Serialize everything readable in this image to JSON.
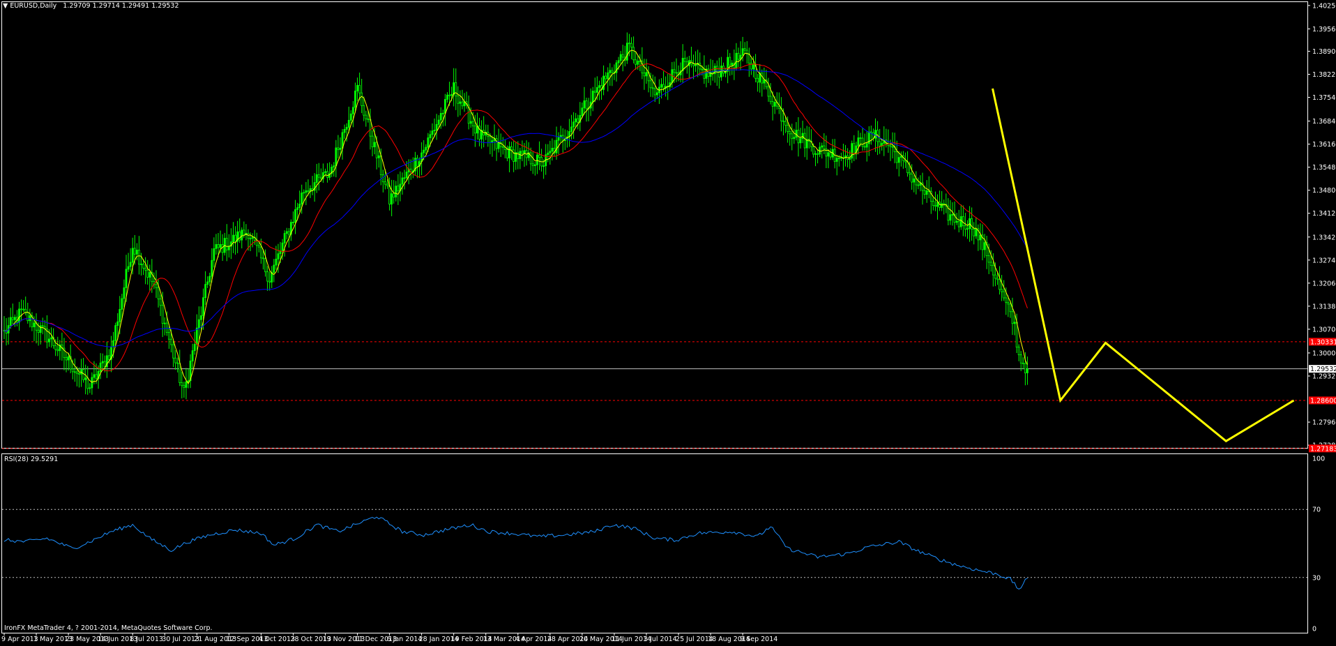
{
  "header": {
    "symbol_label": "EURUSD,Daily",
    "ohlc": "1.29709 1.29714 1.29491 1.29532"
  },
  "footer": {
    "copyright": "IronFX MetaTrader 4, ? 2001-2014, MetaQuotes Software Corp."
  },
  "colors": {
    "background": "#000000",
    "candle": "#00ff00",
    "ma_fast": "#ffff00",
    "ma_mid": "#ff0000",
    "ma_slow": "#0000ff",
    "rsi_line": "#1e90ff",
    "level_lines": "#ff0000",
    "projection": "#ffff00",
    "bid_line": "#c0c0c0"
  },
  "chart_data": [
    {
      "type": "candlestick",
      "symbol": "EURUSD",
      "timeframe": "Daily",
      "y_ticks": [
        "1.40250",
        "1.39560",
        "1.38900",
        "1.38220",
        "1.37540",
        "1.36840",
        "1.36160",
        "1.35480",
        "1.34800",
        "1.34120",
        "1.33420",
        "1.32740",
        "1.32060",
        "1.31380",
        "1.30700",
        "1.30000",
        "1.29320",
        "1.27960",
        "1.27280"
      ],
      "ylim": [
        1.272,
        1.4035
      ],
      "x_ticks": [
        "9 Apr 2013",
        "1 May 2013",
        "23 May 2013",
        "14 Jun 2013",
        "8 Jul 2013",
        "30 Jul 2013",
        "21 Aug 2013",
        "12 Sep 2013",
        "4 Oct 2013",
        "28 Oct 2013",
        "19 Nov 2013",
        "11 Dec 2013",
        "6 Jan 2014",
        "28 Jan 2014",
        "19 Feb 2014",
        "13 Mar 2014",
        "4 Apr 2014",
        "28 Apr 2014",
        "20 May 2014",
        "11 Jun 2014",
        "3 Jul 2014",
        "25 Jul 2014",
        "18 Aug 2014",
        "9 Sep 2014"
      ],
      "close_anchors": [
        [
          0,
          1.306
        ],
        [
          8,
          1.312
        ],
        [
          20,
          1.305
        ],
        [
          40,
          1.29
        ],
        [
          50,
          1.301
        ],
        [
          60,
          1.332
        ],
        [
          70,
          1.32
        ],
        [
          84,
          1.288
        ],
        [
          98,
          1.33
        ],
        [
          114,
          1.336
        ],
        [
          124,
          1.322
        ],
        [
          140,
          1.348
        ],
        [
          152,
          1.353
        ],
        [
          165,
          1.378
        ],
        [
          180,
          1.345
        ],
        [
          196,
          1.36
        ],
        [
          210,
          1.378
        ],
        [
          222,
          1.364
        ],
        [
          236,
          1.359
        ],
        [
          252,
          1.356
        ],
        [
          268,
          1.37
        ],
        [
          282,
          1.382
        ],
        [
          292,
          1.39
        ],
        [
          304,
          1.376
        ],
        [
          316,
          1.385
        ],
        [
          330,
          1.382
        ],
        [
          346,
          1.388
        ],
        [
          354,
          1.38
        ],
        [
          368,
          1.365
        ],
        [
          380,
          1.36
        ],
        [
          392,
          1.358
        ],
        [
          400,
          1.362
        ],
        [
          406,
          1.364
        ],
        [
          414,
          1.361
        ],
        [
          424,
          1.352
        ],
        [
          434,
          1.344
        ],
        [
          445,
          1.339
        ],
        [
          452,
          1.338
        ],
        [
          460,
          1.328
        ],
        [
          466,
          1.317
        ],
        [
          472,
          1.308
        ],
        [
          474,
          1.299
        ],
        [
          478,
          1.2953
        ]
      ],
      "series": [
        {
          "name": "EURUSD",
          "kind": "candles"
        },
        {
          "kind": "moving-average",
          "period": 5
        },
        {
          "kind": "moving-average",
          "period": 21
        },
        {
          "kind": "moving-average",
          "period": 55
        }
      ],
      "levels": [
        {
          "label": "1.30331",
          "value": 1.30331
        },
        {
          "label": "1.29532",
          "value": 1.29532
        },
        {
          "label": "1.28600",
          "value": 1.286
        },
        {
          "label": "1.27183",
          "value": 1.27183
        }
      ],
      "projection_points": [
        [
          1.378,
          0
        ],
        [
          1.286,
          9
        ],
        [
          1.303,
          15
        ],
        [
          1.274,
          31
        ],
        [
          1.286,
          40
        ]
      ]
    },
    {
      "type": "line",
      "title": "RSI(28) 29.5291",
      "y_ticks": [
        "100",
        "70",
        "30",
        "0"
      ],
      "ylim": [
        0,
        100
      ],
      "levels": [
        70,
        30
      ],
      "value_anchors": [
        [
          0,
          52
        ],
        [
          10,
          51
        ],
        [
          20,
          53
        ],
        [
          32,
          47
        ],
        [
          40,
          51
        ],
        [
          50,
          57
        ],
        [
          60,
          61
        ],
        [
          68,
          53
        ],
        [
          78,
          46
        ],
        [
          86,
          51
        ],
        [
          96,
          55
        ],
        [
          108,
          58
        ],
        [
          120,
          56
        ],
        [
          126,
          49
        ],
        [
          136,
          53
        ],
        [
          146,
          61
        ],
        [
          156,
          57
        ],
        [
          168,
          63
        ],
        [
          174,
          66
        ],
        [
          186,
          57
        ],
        [
          196,
          55
        ],
        [
          206,
          58
        ],
        [
          218,
          61
        ],
        [
          226,
          57
        ],
        [
          236,
          56
        ],
        [
          250,
          54
        ],
        [
          262,
          55
        ],
        [
          276,
          57
        ],
        [
          284,
          61
        ],
        [
          294,
          59
        ],
        [
          304,
          53
        ],
        [
          314,
          52
        ],
        [
          324,
          56
        ],
        [
          340,
          57
        ],
        [
          352,
          54
        ],
        [
          358,
          60
        ],
        [
          366,
          47
        ],
        [
          380,
          42
        ],
        [
          394,
          44
        ],
        [
          404,
          48
        ],
        [
          418,
          51
        ],
        [
          426,
          46
        ],
        [
          436,
          41
        ],
        [
          446,
          37
        ],
        [
          456,
          34
        ],
        [
          464,
          32
        ],
        [
          470,
          29
        ],
        [
          474,
          23
        ],
        [
          478,
          29.53
        ]
      ]
    }
  ]
}
